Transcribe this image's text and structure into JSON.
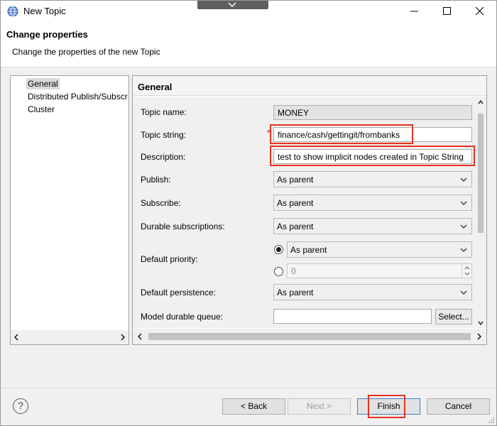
{
  "window": {
    "title": "New Topic"
  },
  "header": {
    "title": "Change properties",
    "subtitle": "Change the properties of the new Topic"
  },
  "tree": {
    "items": [
      {
        "label": "General",
        "selected": true
      },
      {
        "label": "Distributed Publish/Subscr",
        "selected": false
      },
      {
        "label": "Cluster",
        "selected": false
      }
    ]
  },
  "panel": {
    "title": "General",
    "topic_name": {
      "label": "Topic name:",
      "value": "MONEY"
    },
    "topic_string": {
      "label": "Topic string:",
      "value": "finance/cash/gettingit/frombanks",
      "required_marker": "*"
    },
    "description": {
      "label": "Description:",
      "value": "test to show implicit nodes created in Topic String"
    },
    "publish": {
      "label": "Publish:",
      "value": "As parent"
    },
    "subscribe": {
      "label": "Subscribe:",
      "value": "As parent"
    },
    "durable_subscriptions": {
      "label": "Durable subscriptions:",
      "value": "As parent"
    },
    "default_priority": {
      "label": "Default priority:",
      "option_parent": "As parent",
      "option_value": "0"
    },
    "default_persistence": {
      "label": "Default persistence:",
      "value": "As parent"
    },
    "model_durable_queue": {
      "label": "Model durable queue:",
      "value": "",
      "select_label": "Select..."
    }
  },
  "footer": {
    "help_label": "?",
    "back_label": "< Back",
    "next_label": "Next >",
    "finish_label": "Finish",
    "cancel_label": "Cancel"
  },
  "colors": {
    "highlight_red": "#e8321f",
    "default_button_border": "#3c7fd0",
    "required_star": "#d11a1a"
  }
}
